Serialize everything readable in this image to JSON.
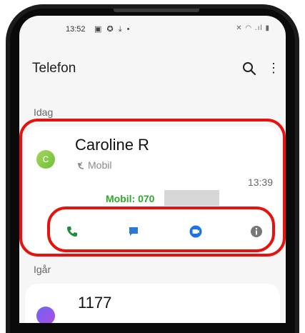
{
  "status_bar": {
    "time": "13:52",
    "left_icons": "▣ ✪ ⤓ •",
    "right_icons": "✕ ◠ .ıl ▮"
  },
  "app_bar": {
    "title": "Telefon",
    "search_icon": "search-icon",
    "more_icon": "more-vert-icon",
    "more_glyph": "⋮"
  },
  "sections": {
    "today": "Idag",
    "yesterday": "Igår"
  },
  "calls": [
    {
      "avatar_letter": "C",
      "name": "Caroline R",
      "type_label": "Mobil",
      "time": "13:39",
      "expanded_number": "Mobil: 070",
      "actions": [
        "call-icon",
        "message-icon",
        "video-call-icon",
        "info-icon"
      ]
    },
    {
      "name": "1177"
    }
  ],
  "colors": {
    "accent_blue": "#1a73e8",
    "call_green": "#1c8b3c",
    "highlight_red": "#e5130f",
    "number_green": "#2ea82e"
  }
}
